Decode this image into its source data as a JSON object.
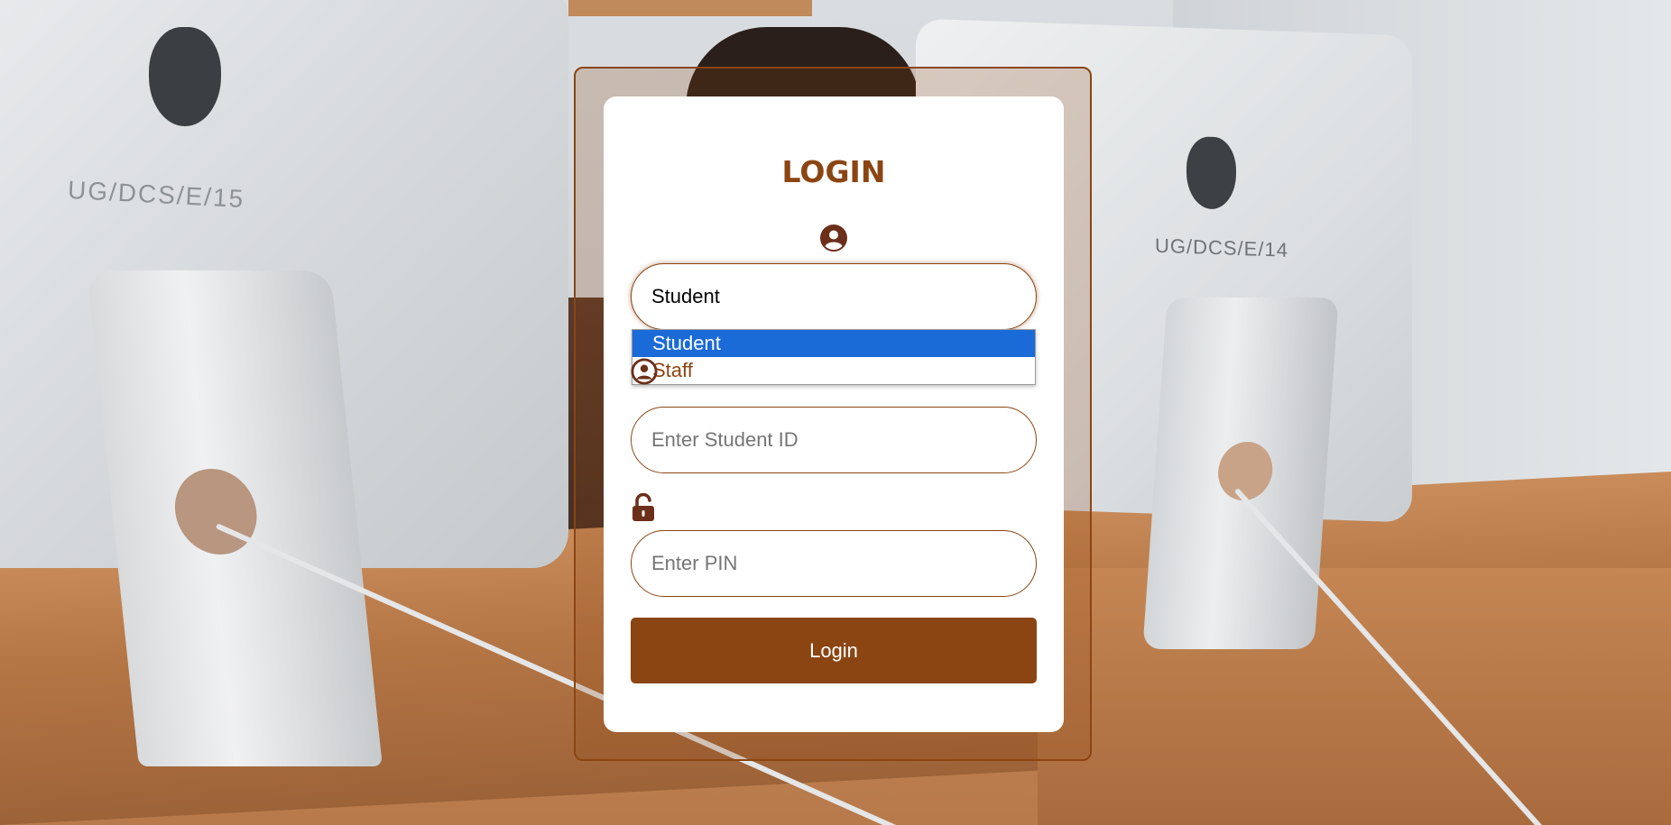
{
  "login": {
    "title": "LOGIN",
    "user_type": {
      "selected": "Student",
      "options": [
        "Student",
        "Staff"
      ]
    },
    "id_field": {
      "placeholder": "Enter Student ID"
    },
    "pin_field": {
      "placeholder": "Enter PIN"
    },
    "submit_label": "Login"
  },
  "background": {
    "left_monitor_tag": "UG/DCS/E/15",
    "right_monitor_tag": "UG/DCS/E/14"
  },
  "colors": {
    "accent": "#8b4513",
    "selected_option": "#1a6ad8",
    "card": "#ffffff"
  },
  "icons": [
    "user-circle-icon",
    "user-circle-icon",
    "unlock-icon"
  ]
}
